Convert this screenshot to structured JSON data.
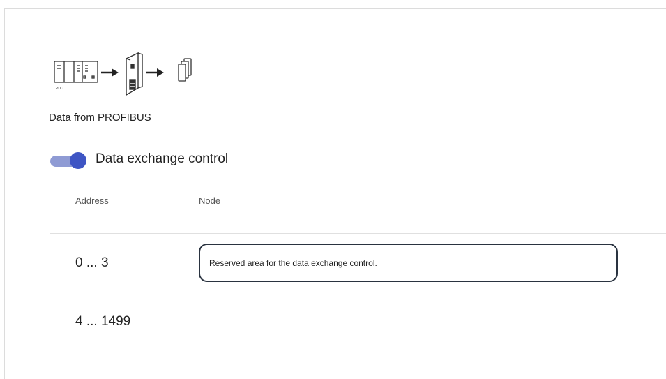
{
  "flow": {
    "icons": [
      "plc-icon",
      "arrow-right-icon",
      "gateway-device-icon",
      "arrow-right-icon",
      "data-pages-icon"
    ],
    "plc_label": "PLC"
  },
  "section": {
    "title": "Data from PROFIBUS"
  },
  "toggle": {
    "label": "Data exchange control",
    "on": true,
    "track_color": "#8f9bd4",
    "knob_color": "#3e55c4"
  },
  "table": {
    "columns": [
      "Address",
      "Node"
    ],
    "rows": [
      {
        "address": "0 ... 3",
        "node": "Reserved area for the data exchange control."
      },
      {
        "address": "4 ... 1499",
        "node": ""
      }
    ]
  }
}
